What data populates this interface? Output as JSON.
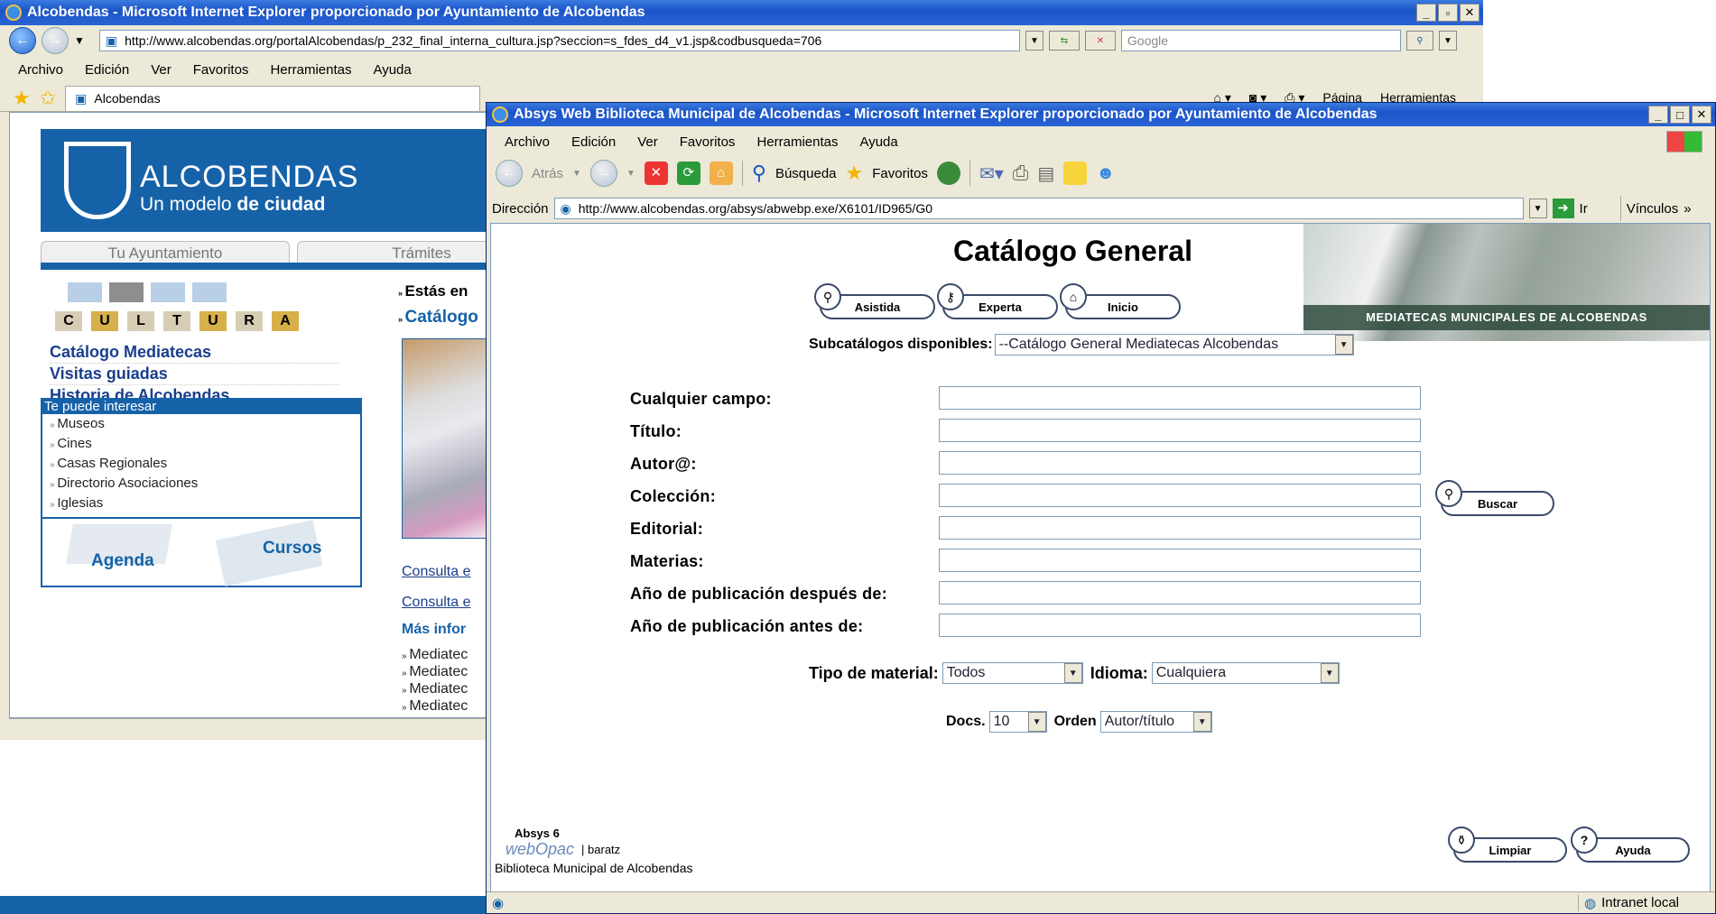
{
  "w1": {
    "title": "Alcobendas - Microsoft Internet Explorer proporcionado por Ayuntamiento de Alcobendas",
    "url": "http://www.alcobendas.org/portalAlcobendas/p_232_final_interna_cultura.jsp?seccion=s_fdes_d4_v1.jsp&codbusqueda=706",
    "search_placeholder": "Google",
    "menu": [
      "Archivo",
      "Edición",
      "Ver",
      "Favoritos",
      "Herramientas",
      "Ayuda"
    ],
    "tab": "Alcobendas",
    "tools": [
      "Página",
      "Herramientas"
    ],
    "banner": {
      "line1": "ALCOBENDAS",
      "line2_a": "Un modelo ",
      "line2_b": "de ciudad"
    },
    "nav_tabs": [
      "Tu Ayuntamiento",
      "Trámites"
    ],
    "cultura_letters": [
      "C",
      "U",
      "L",
      "T",
      "U",
      "R",
      "A"
    ],
    "links": [
      "Catálogo Mediatecas",
      "Visitas guiadas",
      "Historia de Alcobendas"
    ],
    "interes_title": "Te puede interesar",
    "interes_items": [
      "Museos",
      "Cines",
      "Casas Regionales",
      "Directorio Asociaciones",
      "Iglesias"
    ],
    "promo": [
      "Agenda",
      "Cursos"
    ],
    "estas": "Estás en",
    "catal": "Catálogo",
    "consulta": [
      "Consulta e",
      "Consulta e"
    ],
    "mas": "Más infor",
    "mediatecas": [
      "Mediatec",
      "Mediatec",
      "Mediatec",
      "Mediatec"
    ]
  },
  "w2": {
    "title": "Absys Web Biblioteca Municipal de Alcobendas - Microsoft Internet Explorer proporcionado por Ayuntamiento de Alcobendas",
    "menu": [
      "Archivo",
      "Edición",
      "Ver",
      "Favoritos",
      "Herramientas",
      "Ayuda"
    ],
    "back": "Atrás",
    "busqueda": "Búsqueda",
    "favoritos": "Favoritos",
    "dir_label": "Dirección",
    "url": "http://www.alcobendas.org/absys/abwebp.exe/X6101/ID965/G0",
    "ir": "Ir",
    "vinculos": "Vínculos",
    "page_title": "Catálogo General",
    "banner_caption": "MEDIATECAS MUNICIPALES DE ALCOBENDAS",
    "mode_buttons": [
      "Asistida",
      "Experta",
      "Inicio"
    ],
    "subcat_label": "Subcatálogos disponibles:",
    "subcat_value": "--Catálogo General Mediatecas Alcobendas",
    "fields": [
      "Cualquier campo:",
      "Título:",
      "Autor@:",
      "Colección:",
      "Editorial:",
      "Materias:",
      "Año de publicación después de:",
      "Año de publicación antes de:"
    ],
    "buscar": "Buscar",
    "tipo_label": "Tipo de material:",
    "tipo_value": "Todos",
    "idioma_label": "Idioma:",
    "idioma_value": "Cualquiera",
    "docs_label": "Docs.",
    "docs_value": "10",
    "orden_label": "Orden",
    "orden_value": "Autor/título",
    "absys_version": "Absys 6",
    "webopac": "webOpac",
    "baratz": "| baratz",
    "library": "Biblioteca Municipal de Alcobendas",
    "limpiar": "Limpiar",
    "ayuda": "Ayuda",
    "status_zone": "Intranet local"
  },
  "colors": {
    "xp_title": "#2a63d4",
    "brand_blue": "#1662a8",
    "link": "#1a3e8c"
  }
}
